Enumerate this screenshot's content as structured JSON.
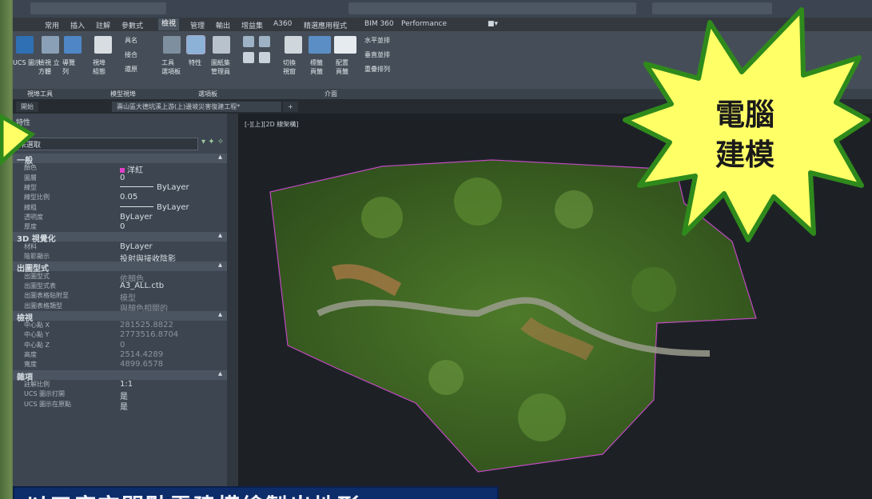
{
  "ribbon": {
    "tabs": [
      "常用",
      "插入",
      "註解",
      "參數式",
      "檢視",
      "管理",
      "輸出",
      "增益集",
      "A360",
      "精選應用程式",
      "BIM 360",
      "Performance"
    ],
    "active_tab": "檢視",
    "buttons": [
      "UCS 圖示",
      "檢視 立方體",
      "導覽 列",
      "視埠 組態",
      "具名",
      "接合",
      "還原",
      "工具 選項板",
      "特性",
      "圖紙集 管理員",
      "切換 視窗",
      "標籤 頁籤",
      "配置 頁籤",
      "水平並排",
      "垂直並排",
      "重疊排列"
    ],
    "panels": [
      "視埠工具",
      "模型視埠",
      "選項板",
      "介面"
    ]
  },
  "doc_tabs": [
    "開始",
    "壽山區大德坑溪上游(上)邊坡災害復建工程*"
  ],
  "properties": {
    "title": "特性",
    "selection": "未選取",
    "sections": [
      {
        "name": "一般",
        "rows": [
          {
            "label": "顏色",
            "value": "洋紅",
            "swatch": "#e040c8"
          },
          {
            "label": "圖層",
            "value": "0"
          },
          {
            "label": "線型",
            "value": "ByLayer",
            "line": true
          },
          {
            "label": "線型比例",
            "value": "0.05"
          },
          {
            "label": "線粗",
            "value": "ByLayer",
            "line": true
          },
          {
            "label": "透明度",
            "value": "ByLayer"
          },
          {
            "label": "厚度",
            "value": "0"
          }
        ]
      },
      {
        "name": "3D 視覺化",
        "rows": [
          {
            "label": "材料",
            "value": "ByLayer"
          },
          {
            "label": "陰影顯示",
            "value": "投射與接收陰影"
          }
        ]
      },
      {
        "name": "出圖型式",
        "rows": [
          {
            "label": "出圖型式",
            "value": "依顏色",
            "dim": true
          },
          {
            "label": "出圖型式表",
            "value": "A3_ALL.ctb"
          },
          {
            "label": "出圖表格貼附至",
            "value": "模型",
            "dim": true
          },
          {
            "label": "出圖表格類型",
            "value": "與顏色相關的",
            "dim": true
          }
        ]
      },
      {
        "name": "檢視",
        "rows": [
          {
            "label": "中心點 X",
            "value": "281525.8822",
            "dim": true
          },
          {
            "label": "中心點 Y",
            "value": "2773516.8704",
            "dim": true
          },
          {
            "label": "中心點 Z",
            "value": "0",
            "dim": true
          },
          {
            "label": "高度",
            "value": "2514.4289",
            "dim": true
          },
          {
            "label": "寬度",
            "value": "4899.6578",
            "dim": true
          }
        ]
      },
      {
        "name": "雜項",
        "rows": [
          {
            "label": "註解比例",
            "value": "1:1"
          },
          {
            "label": "UCS 圖示打開",
            "value": "是"
          },
          {
            "label": "UCS 圖示在原點",
            "value": "是"
          }
        ]
      }
    ]
  },
  "viewport": {
    "label": "[-][上][2D 線架構]"
  },
  "burst": {
    "line1": "電腦",
    "line2": "建模",
    "fill": "#ffff66",
    "stroke": "#2f8a1c"
  },
  "caption": "以三度空間點雲建模繪製出地形"
}
